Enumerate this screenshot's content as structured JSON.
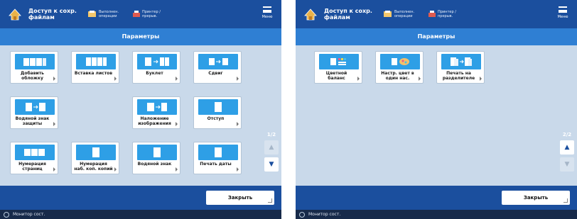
{
  "colors": {
    "topbar": "#1b4f9e",
    "titlebar": "#2f7fd3",
    "background": "#c9d9ea",
    "thumb": "#2e9fe6",
    "status": "#172a4a"
  },
  "screens": [
    {
      "header": {
        "title": "Доступ к сохр. файлам",
        "tb1_label": "Выполнен. операции",
        "tb2_label": "Принтер / прерыв.",
        "menu_label": "Меню"
      },
      "page_title": "Параметры",
      "tiles": [
        {
          "label": "Добавить обложку",
          "icon": "cover-pages-icon"
        },
        {
          "label": "Вставка листов",
          "icon": "insert-sheets-icon"
        },
        {
          "label": "Буклет",
          "icon": "booklet-icon"
        },
        {
          "label": "Сдвиг",
          "icon": "shift-icon"
        },
        {
          "label": "Водяной знак защиты",
          "icon": "secure-watermark-icon"
        },
        {
          "label": "Наложение изображения",
          "icon": "image-overlay-icon"
        },
        {
          "label": "Отступ",
          "icon": "gutter-icon"
        },
        {
          "label": "Нумерация страниц",
          "icon": "page-numbering-icon"
        },
        {
          "label": "Нумерация наб. коп. копий",
          "icon": "copy-set-numbering-icon"
        },
        {
          "label": "Водяной знак",
          "icon": "watermark-icon"
        },
        {
          "label": "Печать даты",
          "icon": "print-date-icon"
        }
      ],
      "pager": {
        "page": "1/2",
        "up": "▲",
        "down": "▼"
      },
      "close_label": "Закрыть",
      "status": "Монитор сост."
    },
    {
      "header": {
        "title": "Доступ к сохр. файлам",
        "tb1_label": "Выполнен. операции",
        "tb2_label": "Принтер / прерыв.",
        "menu_label": "Меню"
      },
      "page_title": "Параметры",
      "tiles": [
        {
          "label": "Цветной баланс",
          "icon": "color-balance-icon"
        },
        {
          "label": "Настр. цвет в один нас.",
          "icon": "one-touch-color-icon"
        },
        {
          "label": "Печать на разделителе",
          "icon": "print-on-tab-icon"
        }
      ],
      "pager": {
        "page": "2/2",
        "up": "▲",
        "down": "▼"
      },
      "close_label": "Закрыть",
      "status": "Монитор сост."
    }
  ]
}
